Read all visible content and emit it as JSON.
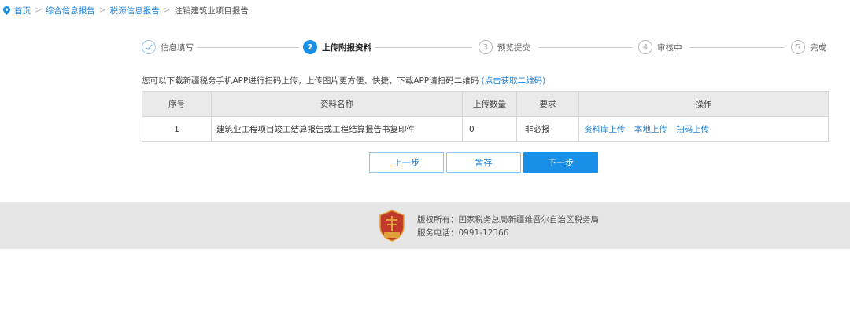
{
  "breadcrumb": {
    "home": "首页",
    "sep": ">",
    "items": [
      "综合信息报告",
      "税源信息报告"
    ],
    "current": "注销建筑业项目报告"
  },
  "steps": [
    {
      "number": "✓",
      "label": "信息填写",
      "state": "done"
    },
    {
      "number": "2",
      "label": "上传附报资料",
      "state": "active"
    },
    {
      "number": "3",
      "label": "预览提交",
      "state": "todo"
    },
    {
      "number": "4",
      "label": "审核中",
      "state": "todo"
    },
    {
      "number": "5",
      "label": "完成",
      "state": "todo"
    }
  ],
  "notice": {
    "text": "您可以下载新疆税务手机APP进行扫码上传，上传图片更方便、快捷，下载APP请扫码二维码",
    "link_open": "(",
    "link": "点击获取二维码",
    "link_close": ")"
  },
  "table": {
    "headers": [
      "序号",
      "资料名称",
      "上传数量",
      "要求",
      "操作"
    ],
    "rows": [
      {
        "index": "1",
        "name": "建筑业工程项目竣工结算报告或工程结算报告书复印件",
        "count": "0",
        "requirement": "非必报",
        "actions": [
          "资料库上传",
          "本地上传",
          "扫码上传"
        ]
      }
    ]
  },
  "buttons": {
    "prev": "上一步",
    "save": "暂存",
    "next": "下一步"
  },
  "footer": {
    "emblem_text": "税收",
    "copyright": "版权所有：国家税务总局新疆维吾尔自治区税务局",
    "phone": "服务电话：0991-12366"
  },
  "colors": {
    "accent": "#1a8fe8",
    "link": "#1a7fd6",
    "emblem_red": "#c0392b",
    "emblem_gold": "#e0a23a"
  }
}
